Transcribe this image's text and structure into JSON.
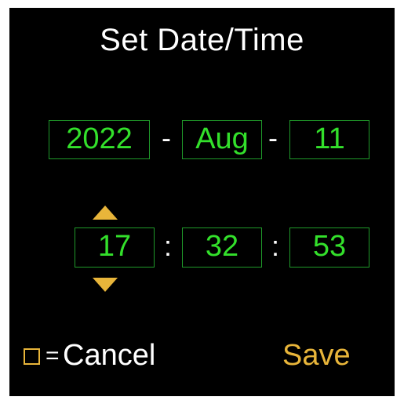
{
  "screen": {
    "title": "Set Date/Time"
  },
  "date": {
    "year": "2022",
    "month": "Aug",
    "day": "11",
    "separator": "-"
  },
  "time": {
    "hours": "17",
    "minutes": "32",
    "seconds": "53",
    "separator": ":"
  },
  "footer": {
    "cancel_equals": "=",
    "cancel_label": "Cancel",
    "save_label": "Save"
  },
  "colors": {
    "background": "#000000",
    "field_text": "#33e02b",
    "field_border": "#1f9a2a",
    "accent": "#e8b53a",
    "text": "#ffffff"
  }
}
